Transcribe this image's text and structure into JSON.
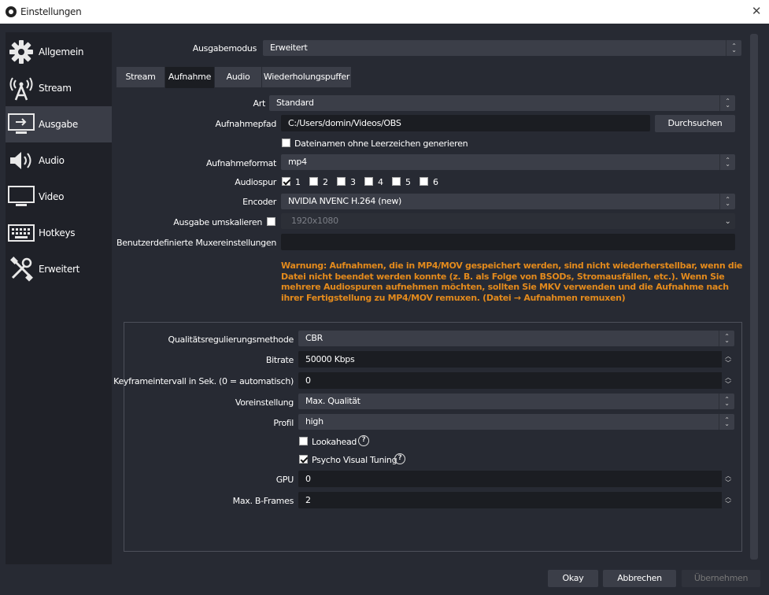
{
  "window": {
    "title": "Einstellungen",
    "close_icon": "close-icon"
  },
  "sidebar": {
    "items": [
      {
        "label": "Allgemein",
        "icon": "gear-icon",
        "active": false
      },
      {
        "label": "Stream",
        "icon": "broadcast-tower-icon",
        "active": false
      },
      {
        "label": "Ausgabe",
        "icon": "monitor-output-icon",
        "active": true
      },
      {
        "label": "Audio",
        "icon": "speaker-icon",
        "active": false
      },
      {
        "label": "Video",
        "icon": "monitor-icon",
        "active": false
      },
      {
        "label": "Hotkeys",
        "icon": "keyboard-icon",
        "active": false
      },
      {
        "label": "Erweitert",
        "icon": "tools-icon",
        "active": false
      }
    ]
  },
  "output_mode": {
    "label": "Ausgabemodus",
    "value": "Erweitert"
  },
  "tabs": [
    {
      "label": "Stream",
      "active": false
    },
    {
      "label": "Aufnahme",
      "active": true
    },
    {
      "label": "Audio",
      "active": false
    },
    {
      "label": "Wiederholungspuffer",
      "active": false
    }
  ],
  "recording": {
    "type": {
      "label": "Art",
      "value": "Standard"
    },
    "path": {
      "label": "Aufnahmepfad",
      "value": "C:/Users/domin/Videos/OBS",
      "browse": "Durchsuchen"
    },
    "no_spaces": {
      "label": "Dateinamen ohne Leerzeichen generieren",
      "checked": false
    },
    "format": {
      "label": "Aufnahmeformat",
      "value": "mp4"
    },
    "audio_track": {
      "label": "Audiospur",
      "tracks": [
        {
          "label": "1",
          "checked": true
        },
        {
          "label": "2",
          "checked": false
        },
        {
          "label": "3",
          "checked": false
        },
        {
          "label": "4",
          "checked": false
        },
        {
          "label": "5",
          "checked": false
        },
        {
          "label": "6",
          "checked": false
        }
      ]
    },
    "encoder": {
      "label": "Encoder",
      "value": "NVIDIA NVENC H.264 (new)"
    },
    "rescale": {
      "label": "Ausgabe umskalieren",
      "checked": false,
      "value": "1920x1080"
    },
    "muxer": {
      "label": "Benutzerdefinierte Muxereinstellungen",
      "value": ""
    },
    "warning": "Warnung: Aufnahmen, die in MP4/MOV gespeichert werden, sind nicht wiederherstellbar, wenn die Datei nicht beendet werden konnte (z. B. als Folge von BSODs, Stromausfällen, etc.). Wenn Sie mehrere Audiospuren aufnehmen möchten, sollten Sie MKV verwenden und die Aufnahme nach ihrer Fertigstellung zu MP4/MOV remuxen. (Datei → Aufnahmen remuxen)",
    "warning_color": "#e38a1c"
  },
  "encoder_settings": {
    "rate_control": {
      "label": "Qualitätsregulierungsmethode",
      "value": "CBR"
    },
    "bitrate": {
      "label": "Bitrate",
      "value": "50000 Kbps"
    },
    "keyframe": {
      "label": "Keyframeintervall in Sek. (0 = automatisch)",
      "value": "0"
    },
    "preset": {
      "label": "Voreinstellung",
      "value": "Max. Qualität"
    },
    "profile": {
      "label": "Profil",
      "value": "high"
    },
    "lookahead": {
      "label": "Lookahead",
      "checked": false
    },
    "psycho": {
      "label": "Psycho Visual Tuning",
      "checked": true
    },
    "gpu": {
      "label": "GPU",
      "value": "0"
    },
    "bframes": {
      "label": "Max. B-Frames",
      "value": "2"
    }
  },
  "footer": {
    "ok": "Okay",
    "cancel": "Abbrechen",
    "apply": "Übernehmen"
  }
}
